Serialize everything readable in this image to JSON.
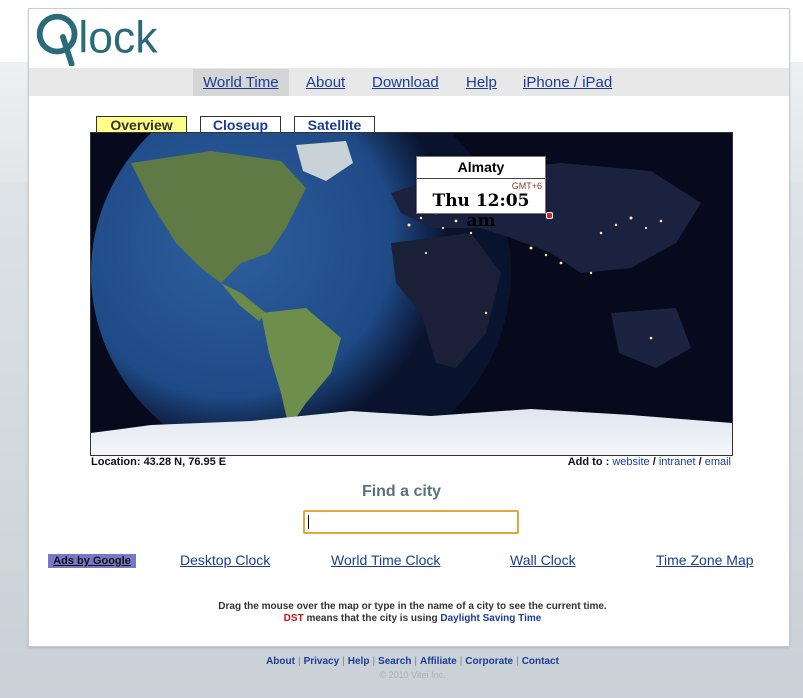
{
  "brand": {
    "logo_text": "Qlock",
    "accent": "#2a6b7a"
  },
  "nav": {
    "items": [
      {
        "label": "World Time",
        "active": true
      },
      {
        "label": "About"
      },
      {
        "label": "Download"
      },
      {
        "label": "Help"
      },
      {
        "label": "iPhone / iPad"
      }
    ]
  },
  "tabs": [
    {
      "label": "Overview",
      "active": true
    },
    {
      "label": "Closeup"
    },
    {
      "label": "Satellite"
    }
  ],
  "popup": {
    "city": "Almaty",
    "gmt": "GMT+6",
    "time": "Thu 12:05 am"
  },
  "location": {
    "label": "Location:",
    "value": "43.28 N, 76.95 E"
  },
  "add_to": {
    "label": "Add to :",
    "website": "website",
    "intranet": "intranet",
    "email": "email",
    "sep": "/"
  },
  "find": {
    "title": "Find a city",
    "value": ""
  },
  "ads": {
    "label": "Ads by Google",
    "links": [
      "Desktop Clock",
      "World Time Clock",
      "Wall Clock",
      "Time Zone Map"
    ]
  },
  "note": {
    "line1": "Drag the mouse over the map or type in the name of a city to see the current time.",
    "dst": "DST",
    "line2_mid": " means that the city is using ",
    "line2_link": "Daylight Saving Time"
  },
  "footer": {
    "links": [
      "About",
      "Privacy",
      "Help",
      "Search",
      "Affiliate",
      "Corporate",
      "Contact"
    ],
    "copyright": "© 2010 Vitei Inc."
  }
}
